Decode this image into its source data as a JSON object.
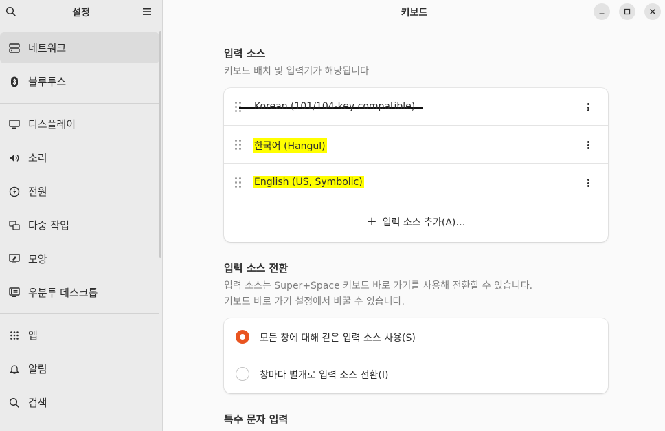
{
  "sidebar": {
    "title": "설정",
    "items": [
      {
        "label": "네트워크",
        "icon": "network-icon"
      },
      {
        "label": "블루투스",
        "icon": "bluetooth-icon"
      },
      {
        "label": "디스플레이",
        "icon": "display-icon"
      },
      {
        "label": "소리",
        "icon": "speaker-icon"
      },
      {
        "label": "전원",
        "icon": "power-icon"
      },
      {
        "label": "다중 작업",
        "icon": "multitasking-icon"
      },
      {
        "label": "모양",
        "icon": "appearance-icon"
      },
      {
        "label": "우분투 데스크톱",
        "icon": "ubuntu-desktop-icon"
      },
      {
        "label": "앱",
        "icon": "apps-grid-icon"
      },
      {
        "label": "알림",
        "icon": "bell-icon"
      },
      {
        "label": "검색",
        "icon": "search-icon"
      }
    ]
  },
  "main": {
    "title": "키보드",
    "input_sources": {
      "title": "입력 소스",
      "description": "키보드 배치 및 입력기가 해당됩니다",
      "rows": [
        {
          "label": "Korean (101/104-key compatible)",
          "style": "strikethrough"
        },
        {
          "label": "한국어 (Hangul)",
          "style": "highlight"
        },
        {
          "label": "English (US, Symbolic)",
          "style": "highlight"
        }
      ],
      "add_label": "입력 소스 추가(A)…"
    },
    "switching": {
      "title": "입력 소스 전환",
      "description_line1": "입력 소스는 Super+Space 키보드 바로 가기를 사용해 전환할 수 있습니다.",
      "description_line2": "키보드 바로 가기 설정에서 바꿀 수 있습니다.",
      "options": [
        {
          "label": "모든 창에 대해 같은 입력 소스 사용(S)",
          "selected": true
        },
        {
          "label": "창마다 별개로 입력 소스 전환(I)",
          "selected": false
        }
      ]
    },
    "special": {
      "title": "특수 문자 입력"
    }
  },
  "colors": {
    "accent": "#e95420",
    "highlight": "#ffff00",
    "sidebar_bg": "#ebebeb",
    "selected_bg": "#dcdcdc"
  }
}
